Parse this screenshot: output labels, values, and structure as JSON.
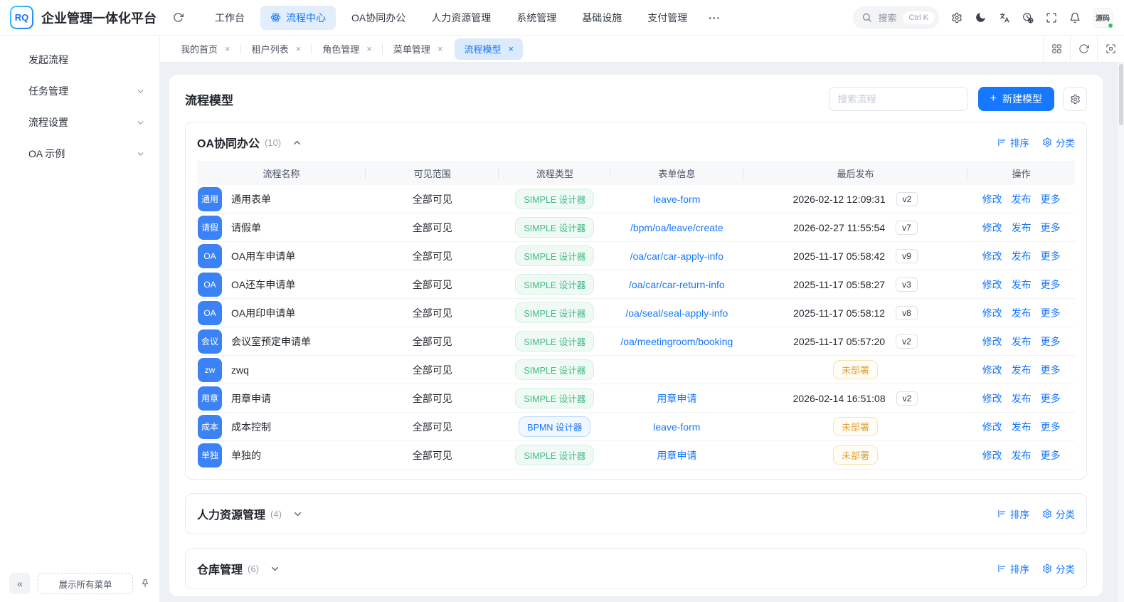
{
  "app": {
    "logo_text": "RQ",
    "title": "企业管理一体化平台"
  },
  "topnav": {
    "items": [
      {
        "label": "工作台"
      },
      {
        "label": "流程中心"
      },
      {
        "label": "OA协同办公"
      },
      {
        "label": "人力资源管理"
      },
      {
        "label": "系统管理"
      },
      {
        "label": "基础设施"
      },
      {
        "label": "支付管理"
      },
      {
        "label": "···"
      }
    ],
    "search_placeholder": "搜索",
    "search_shortcut": "Ctrl K",
    "avatar_label": "源码"
  },
  "sidebar": {
    "items": [
      {
        "label": "发起流程",
        "expandable": false
      },
      {
        "label": "任务管理",
        "expandable": true
      },
      {
        "label": "流程设置",
        "expandable": true
      },
      {
        "label": "OA 示例",
        "expandable": true
      }
    ],
    "collapse_label": "«",
    "show_all_menus_label": "展示所有菜单"
  },
  "tabbar": {
    "close_glyph": "×",
    "tabs": [
      {
        "label": "我的首页"
      },
      {
        "label": "租户列表"
      },
      {
        "label": "角色管理"
      },
      {
        "label": "菜单管理"
      },
      {
        "label": "流程模型"
      }
    ]
  },
  "page": {
    "title": "流程模型",
    "search_placeholder": "搜索流程",
    "plus_glyph": "+",
    "new_model_label": "新建模型"
  },
  "table": {
    "columns": [
      "流程名称",
      "可见范围",
      "流程类型",
      "表单信息",
      "最后发布",
      "操作"
    ],
    "actions": [
      "修改",
      "发布",
      "更多"
    ]
  },
  "sections": [
    {
      "title": "OA协同办公",
      "count": "(10)",
      "expanded": true,
      "sort_label": "排序",
      "classify_label": "分类",
      "rows": [
        {
          "badge": "通用",
          "name": "通用表单",
          "visibility": "全部可见",
          "type": "SIMPLE 设计器",
          "type_kind": "simple",
          "form": "leave-form",
          "published": "2026-02-12 12:09:31",
          "version": "v2",
          "status": ""
        },
        {
          "badge": "请假",
          "name": "请假单",
          "visibility": "全部可见",
          "type": "SIMPLE 设计器",
          "type_kind": "simple",
          "form": "/bpm/oa/leave/create",
          "published": "2026-02-27 11:55:54",
          "version": "v7",
          "status": ""
        },
        {
          "badge": "OA",
          "name": "OA用车申请单",
          "visibility": "全部可见",
          "type": "SIMPLE 设计器",
          "type_kind": "simple",
          "form": "/oa/car/car-apply-info",
          "published": "2025-11-17 05:58:42",
          "version": "v9",
          "status": ""
        },
        {
          "badge": "OA",
          "name": "OA还车申请单",
          "visibility": "全部可见",
          "type": "SIMPLE 设计器",
          "type_kind": "simple",
          "form": "/oa/car/car-return-info",
          "published": "2025-11-17 05:58:27",
          "version": "v3",
          "status": ""
        },
        {
          "badge": "OA",
          "name": "OA用印申请单",
          "visibility": "全部可见",
          "type": "SIMPLE 设计器",
          "type_kind": "simple",
          "form": "/oa/seal/seal-apply-info",
          "published": "2025-11-17 05:58:12",
          "version": "v8",
          "status": ""
        },
        {
          "badge": "会议",
          "name": "会议室预定申请单",
          "visibility": "全部可见",
          "type": "SIMPLE 设计器",
          "type_kind": "simple",
          "form": "/oa/meetingroom/booking",
          "published": "2025-11-17 05:57:20",
          "version": "v2",
          "status": ""
        },
        {
          "badge": "zw",
          "name": "zwq",
          "visibility": "全部可见",
          "type": "SIMPLE 设计器",
          "type_kind": "simple",
          "form": "",
          "published": "",
          "version": "",
          "status": "未部署"
        },
        {
          "badge": "用章",
          "name": "用章申请",
          "visibility": "全部可见",
          "type": "SIMPLE 设计器",
          "type_kind": "simple",
          "form": "用章申请",
          "published": "2026-02-14 16:51:08",
          "version": "v2",
          "status": ""
        },
        {
          "badge": "成本",
          "name": "成本控制",
          "visibility": "全部可见",
          "type": "BPMN 设计器",
          "type_kind": "bpmn",
          "form": "leave-form",
          "published": "",
          "version": "",
          "status": "未部署"
        },
        {
          "badge": "单独",
          "name": "单独的",
          "visibility": "全部可见",
          "type": "SIMPLE 设计器",
          "type_kind": "simple",
          "form": "用章申请",
          "published": "",
          "version": "",
          "status": "未部署"
        }
      ]
    },
    {
      "title": "人力资源管理",
      "count": "(4)",
      "expanded": false,
      "sort_label": "排序",
      "classify_label": "分类"
    },
    {
      "title": "仓库管理",
      "count": "(6)",
      "expanded": false,
      "sort_label": "排序",
      "classify_label": "分类"
    }
  ],
  "colors": {
    "primary": "#1677ff",
    "nav_active_bg": "#e3eefc",
    "row_badge_bg": "#3b82f6",
    "simple_badge_text": "#42b983",
    "simple_badge_bg": "#eefaf3",
    "bpmn_badge_text": "#1677ff",
    "bpmn_badge_bg": "#f0f7ff",
    "not_deployed_text": "#dda43c",
    "not_deployed_bg": "#fffdf5",
    "avatar_status_dot": "#34c759"
  }
}
